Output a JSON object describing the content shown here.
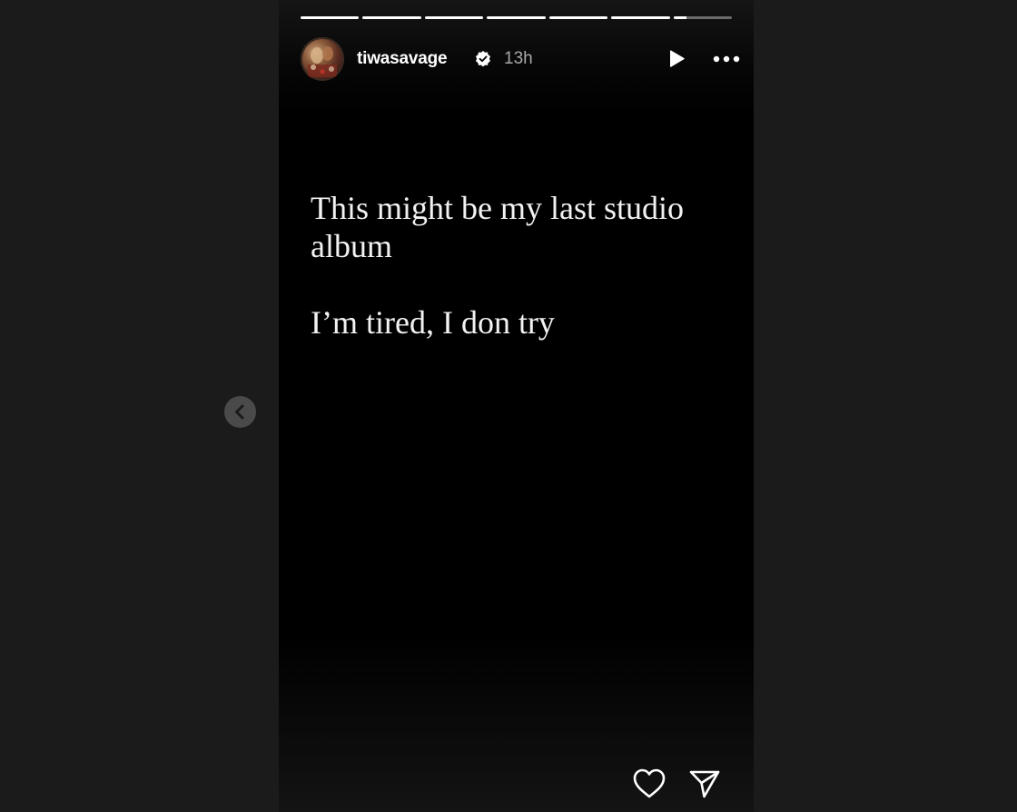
{
  "story": {
    "progress": {
      "segment_count": 7,
      "current_segment_index": 6,
      "current_segment_fraction": 0.22
    },
    "header": {
      "username": "tiwasavage",
      "verified": true,
      "time_ago": "13h",
      "avatar_icon": "profile-photo",
      "play_icon": "play-icon",
      "more_icon": "more-horizontal-icon"
    },
    "text": {
      "line1": "This might be my last studio album",
      "line2": "I’m tired, I don try"
    },
    "footer": {
      "like_icon": "heart-icon",
      "share_icon": "paper-plane-icon"
    }
  },
  "navigation": {
    "prev_icon": "chevron-left-icon"
  },
  "colors": {
    "page_background": "#1b1b1b",
    "story_background": "#000000",
    "text": "#f2f2f2",
    "muted": "#a8a8a8",
    "nav_button": "#4a4a4a"
  }
}
